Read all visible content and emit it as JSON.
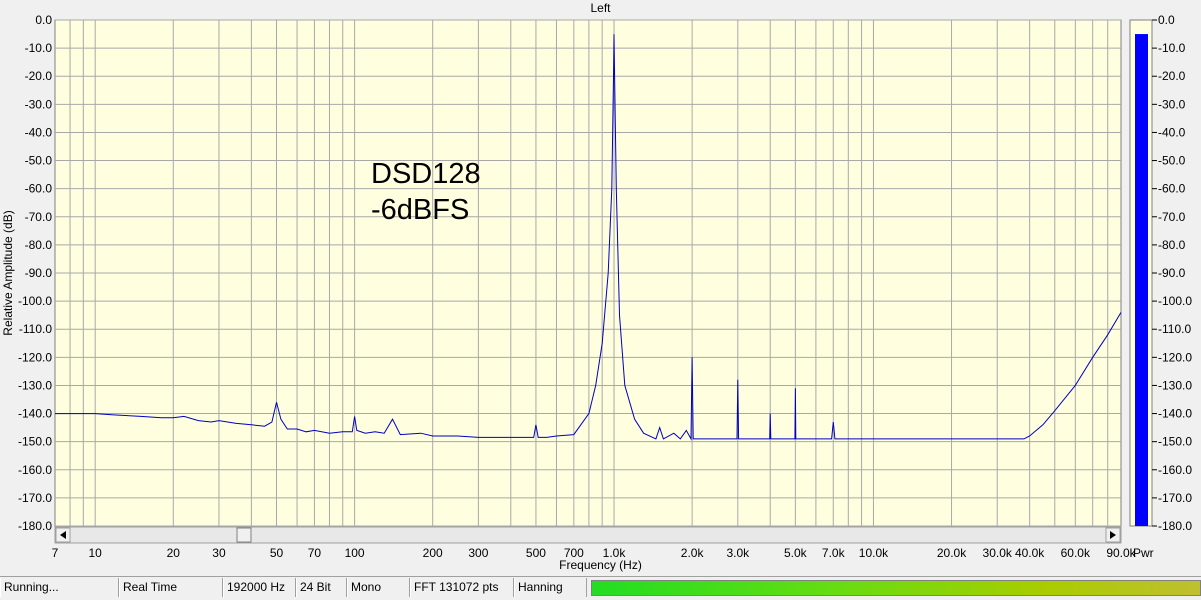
{
  "window": {
    "channel_title": "Left"
  },
  "annotation": {
    "line1": "DSD128",
    "line2": "-6dBFS"
  },
  "status": {
    "state": "Running...",
    "mode": "Real Time",
    "sample_rate": "192000 Hz",
    "bit_depth": "24 Bit",
    "channels": "Mono",
    "fft": "FFT 131072 pts",
    "window": "Hanning",
    "meter_level": 1.0
  },
  "colors": {
    "plot_bg": "#ffffe0",
    "trace": "#0000c0",
    "grid": "#a8a8a8",
    "meter_bar": "#0000ff",
    "meter_bg": "#ffffe0"
  },
  "icons": {
    "scroll_left": "left-arrow-icon",
    "scroll_right": "right-arrow-icon"
  },
  "chart_data": {
    "type": "line",
    "title": "Left",
    "xlabel": "Frequency (Hz)",
    "ylabel": "Relative Amplitude (dB)",
    "xscale": "log",
    "xlim": [
      7,
      90000
    ],
    "ylim": [
      -180,
      0
    ],
    "grid": true,
    "x_ticks": [
      7,
      10,
      20,
      30,
      50,
      70,
      100,
      200,
      300,
      500,
      700,
      1000,
      2000,
      3000,
      5000,
      7000,
      10000,
      20000,
      30000,
      40000,
      60000,
      90000
    ],
    "x_tick_labels": [
      "7",
      "10",
      "20",
      "30",
      "50",
      "70",
      "100",
      "200",
      "300",
      "500",
      "700",
      "1.0k",
      "2.0k",
      "3.0k",
      "5.0k",
      "7.0k",
      "10.0k",
      "20.0k",
      "30.0k",
      "40.0k",
      "60.0k",
      "90.0k"
    ],
    "y_ticks": [
      0,
      -10,
      -20,
      -30,
      -40,
      -50,
      -60,
      -70,
      -80,
      -90,
      -100,
      -110,
      -120,
      -130,
      -140,
      -150,
      -160,
      -170,
      -180
    ],
    "y_tick_labels": [
      "0.0",
      "-10.0",
      "-20.0",
      "-30.0",
      "-40.0",
      "-50.0",
      "-60.0",
      "-70.0",
      "-80.0",
      "-90.0",
      "-100.0",
      "-110.0",
      "-120.0",
      "-130.0",
      "-140.0",
      "-150.0",
      "-160.0",
      "-170.0",
      "-180.0"
    ],
    "series": [
      {
        "x": [
          7,
          10,
          12,
          15,
          18,
          20,
          22,
          25,
          28,
          30,
          35,
          40,
          45,
          48,
          50,
          52,
          55,
          60,
          65,
          70,
          80,
          90,
          98,
          100,
          102,
          110,
          120,
          130,
          140,
          150,
          180,
          200,
          250,
          300,
          400,
          480,
          490,
          500,
          510,
          550,
          600,
          700,
          800,
          850,
          900,
          950,
          980,
          995,
          1000,
          1005,
          1020,
          1050,
          1100,
          1200,
          1300,
          1450,
          1500,
          1550,
          1700,
          1800,
          1900,
          1980,
          2000,
          2020,
          2200,
          2500,
          2900,
          2980,
          3000,
          3020,
          3200,
          3900,
          3980,
          4000,
          4020,
          4500,
          4980,
          5000,
          5020,
          6000,
          6900,
          7000,
          7100,
          8000,
          10000,
          15000,
          20000,
          30000,
          38000,
          40000,
          45000,
          50000,
          60000,
          70000,
          80000,
          90000
        ],
        "y": [
          -140,
          -140,
          -140.5,
          -141,
          -141.5,
          -141.5,
          -141,
          -142.5,
          -143,
          -142.5,
          -143.5,
          -144,
          -144.5,
          -143,
          -136,
          -142,
          -145.5,
          -145.5,
          -146.5,
          -146,
          -147,
          -146.5,
          -146.5,
          -141,
          -146,
          -147,
          -146.5,
          -147,
          -142,
          -147.5,
          -147,
          -148,
          -148,
          -148.5,
          -148.5,
          -148.5,
          -148.5,
          -144,
          -148.5,
          -148.5,
          -148,
          -147.5,
          -140,
          -130,
          -115,
          -90,
          -60,
          -20,
          -5,
          -20,
          -60,
          -105,
          -130,
          -142,
          -147,
          -149,
          -145,
          -149,
          -147,
          -149,
          -146,
          -149,
          -120,
          -149,
          -149,
          -149,
          -149,
          -149,
          -128,
          -149,
          -149,
          -149,
          -149,
          -140,
          -149,
          -149,
          -149,
          -131,
          -149,
          -149,
          -149,
          -143,
          -149,
          -149,
          -149,
          -149,
          -149,
          -149,
          -149,
          -148,
          -144,
          -139,
          -130,
          -120,
          -112,
          -104
        ]
      }
    ],
    "meter": {
      "label": "Pwr",
      "value": -5
    }
  }
}
